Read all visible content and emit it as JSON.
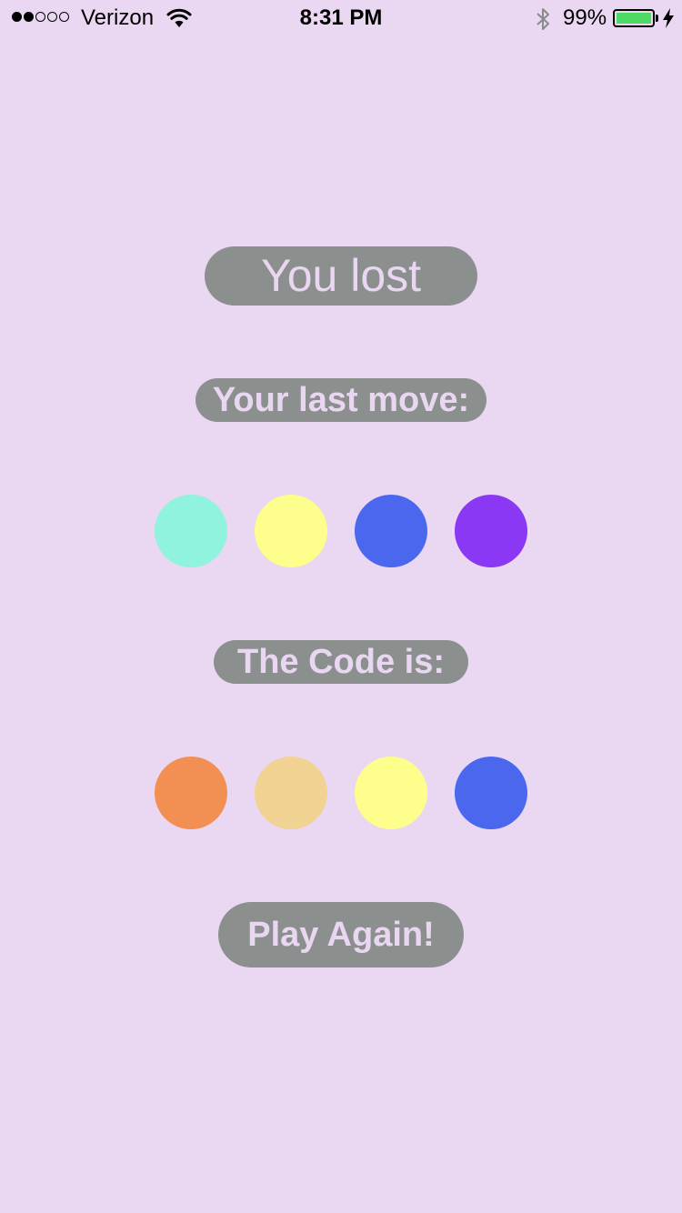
{
  "theme": {
    "background": "#ead7f1",
    "pill_background": "#8b908f",
    "pill_text": "#e9d6f0"
  },
  "status_bar": {
    "signal_bars_filled": 2,
    "signal_bars_total": 5,
    "carrier": "Verizon",
    "time": "8:31 PM",
    "battery_percent": "99%",
    "battery_level": 0.99,
    "battery_color": "#4cd964",
    "icons": [
      "wifi-icon",
      "bluetooth-icon",
      "battery-icon",
      "charging-bolt-icon"
    ]
  },
  "game": {
    "result_title": "You lost",
    "last_move_label": "Your last move:",
    "last_move": [
      {
        "color": "#90f3dd"
      },
      {
        "color": "#fefe8c"
      },
      {
        "color": "#4a67ee"
      },
      {
        "color": "#8a38f4"
      }
    ],
    "code_label": "The Code is:",
    "code": [
      {
        "color": "#f28f53"
      },
      {
        "color": "#f0d293"
      },
      {
        "color": "#fefe8c"
      },
      {
        "color": "#4a67ee"
      }
    ],
    "play_again_label": "Play Again!"
  }
}
